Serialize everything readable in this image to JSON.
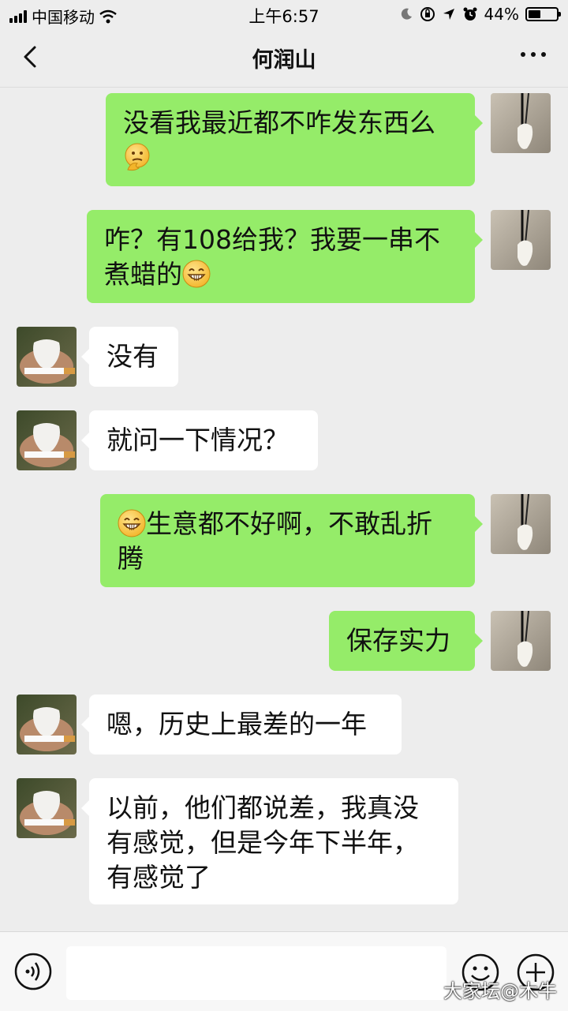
{
  "status_bar": {
    "carrier": "中国移动",
    "time": "上午6:57",
    "battery": "44%",
    "battery_level": 0.44
  },
  "header": {
    "title": "何润山",
    "back_icon": "chevron-left-icon",
    "more_icon": "more-dots-icon"
  },
  "messages": [
    {
      "side": "sent",
      "text": "没看我最近都不咋发东西么",
      "emoji_after": "thinking-face"
    },
    {
      "side": "sent",
      "text_line1": "咋？有108给我？我要一串不",
      "text_line2": "煮蜡的",
      "emoji_after": "grinning-face"
    },
    {
      "side": "recv",
      "text": "没有"
    },
    {
      "side": "recv",
      "text": "就问一下情况？"
    },
    {
      "side": "sent",
      "emoji_before": "grinning-face",
      "text_line1": "生意都不好啊，不敢乱折",
      "text_line2": "腾"
    },
    {
      "side": "sent",
      "text": "保存实力"
    },
    {
      "side": "recv",
      "text": "嗯，历史上最差的一年"
    },
    {
      "side": "recv",
      "text_line1": "以前，他们都说差，我真没",
      "text_line2": "有感觉，但是今年下半年，",
      "text_line3": "有感觉了"
    }
  ],
  "input_bar": {
    "voice_icon": "voice-icon",
    "emoji_icon": "emoji-icon",
    "plus_icon": "plus-circle-icon"
  },
  "watermark": "大家坛@木牛"
}
